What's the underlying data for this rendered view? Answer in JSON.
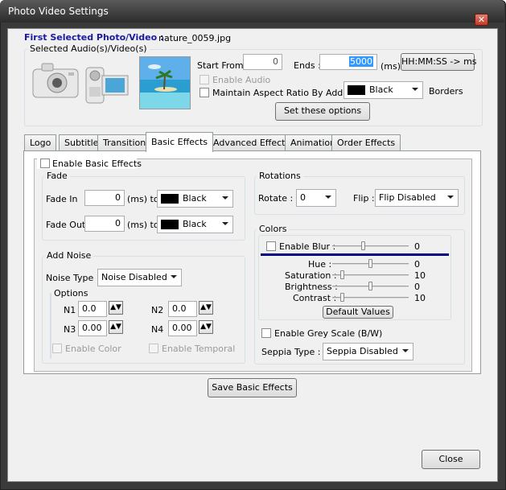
{
  "window": {
    "title": "Photo Video Settings",
    "close_glyph": "✕"
  },
  "header": {
    "first_selected_label": "First Selected Photo/Video :",
    "filename": "nature_0059.jpg",
    "selected_av_label": "Selected Audio(s)/Video(s)"
  },
  "timing": {
    "start_from_label": "Start From :",
    "start_from_value": "0",
    "ends_label": "Ends :",
    "ends_value": "5000",
    "ms_unit": "(ms)",
    "convert_button": "HH:MM:SS -> ms"
  },
  "audio": {
    "enable_audio_label": "Enable Audio",
    "maintain_aspect_label": "Maintain Aspect Ratio By Adding",
    "border_color": "Black",
    "borders_label": "Borders",
    "set_options_button": "Set these options"
  },
  "tabs": [
    "Logo",
    "Subtitle",
    "Transitions",
    "Basic Effects",
    "Advanced Effects",
    "Animation",
    "Order Effects"
  ],
  "active_tab": "Basic Effects",
  "basic": {
    "enable_label": "Enable Basic Effects",
    "fade": {
      "title": "Fade",
      "fade_in_label": "Fade In",
      "fade_in_value": "0",
      "fade_out_label": "Fade Out",
      "fade_out_value": "0",
      "ms_to": "(ms) to:",
      "fade_in_color": "Black",
      "fade_out_color": "Black"
    },
    "rotations": {
      "title": "Rotations",
      "rotate_label": "Rotate :",
      "rotate_value": "0",
      "flip_label": "Flip :",
      "flip_value": "Flip Disabled"
    },
    "noise": {
      "title": "Add Noise",
      "type_label": "Noise Type :",
      "type_value": "Noise Disabled",
      "options_title": "Options",
      "n1_label": "N1",
      "n1_value": "0.0",
      "n2_label": "N2",
      "n2_value": "0.0",
      "n3_label": "N3",
      "n3_value": "0.00",
      "n4_label": "N4",
      "n4_value": "0.00",
      "enable_color_label": "Enable Color",
      "enable_temporal_label": "Enable Temporal"
    },
    "colors": {
      "title": "Colors",
      "enable_blur_label": "Enable Blur :",
      "blur_value": "0",
      "hue_label": "Hue :",
      "hue_value": "0",
      "saturation_label": "Saturation :",
      "saturation_value": "10",
      "brightness_label": "Brightness :",
      "brightness_value": "0",
      "contrast_label": "Contrast :",
      "contrast_value": "10",
      "default_button": "Default Values",
      "grey_label": "Enable Grey Scale (B/W)",
      "seppia_label": "Seppia Type :",
      "seppia_value": "Seppia Disabled"
    },
    "save_button": "Save Basic Effects"
  },
  "footer": {
    "close_button": "Close"
  },
  "colors": {
    "accent": "#000080",
    "title_text": "#1a1aa0"
  }
}
